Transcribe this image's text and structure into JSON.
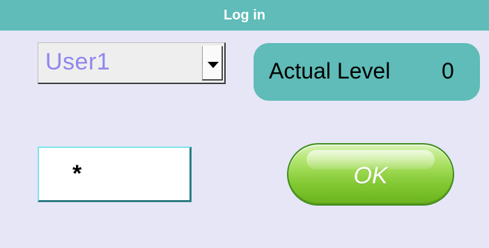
{
  "window": {
    "title": "Log in"
  },
  "login": {
    "user_select": {
      "value": "User1",
      "icon": "chevron-down-icon"
    },
    "level_label": "Actual Level",
    "level_value": "0",
    "password_mask": "*",
    "ok_label": "OK"
  },
  "colors": {
    "background": "#e6e6f7",
    "accent": "#5fbcb8",
    "button_green": "#7fc62f",
    "user_text": "#8f86ee"
  }
}
